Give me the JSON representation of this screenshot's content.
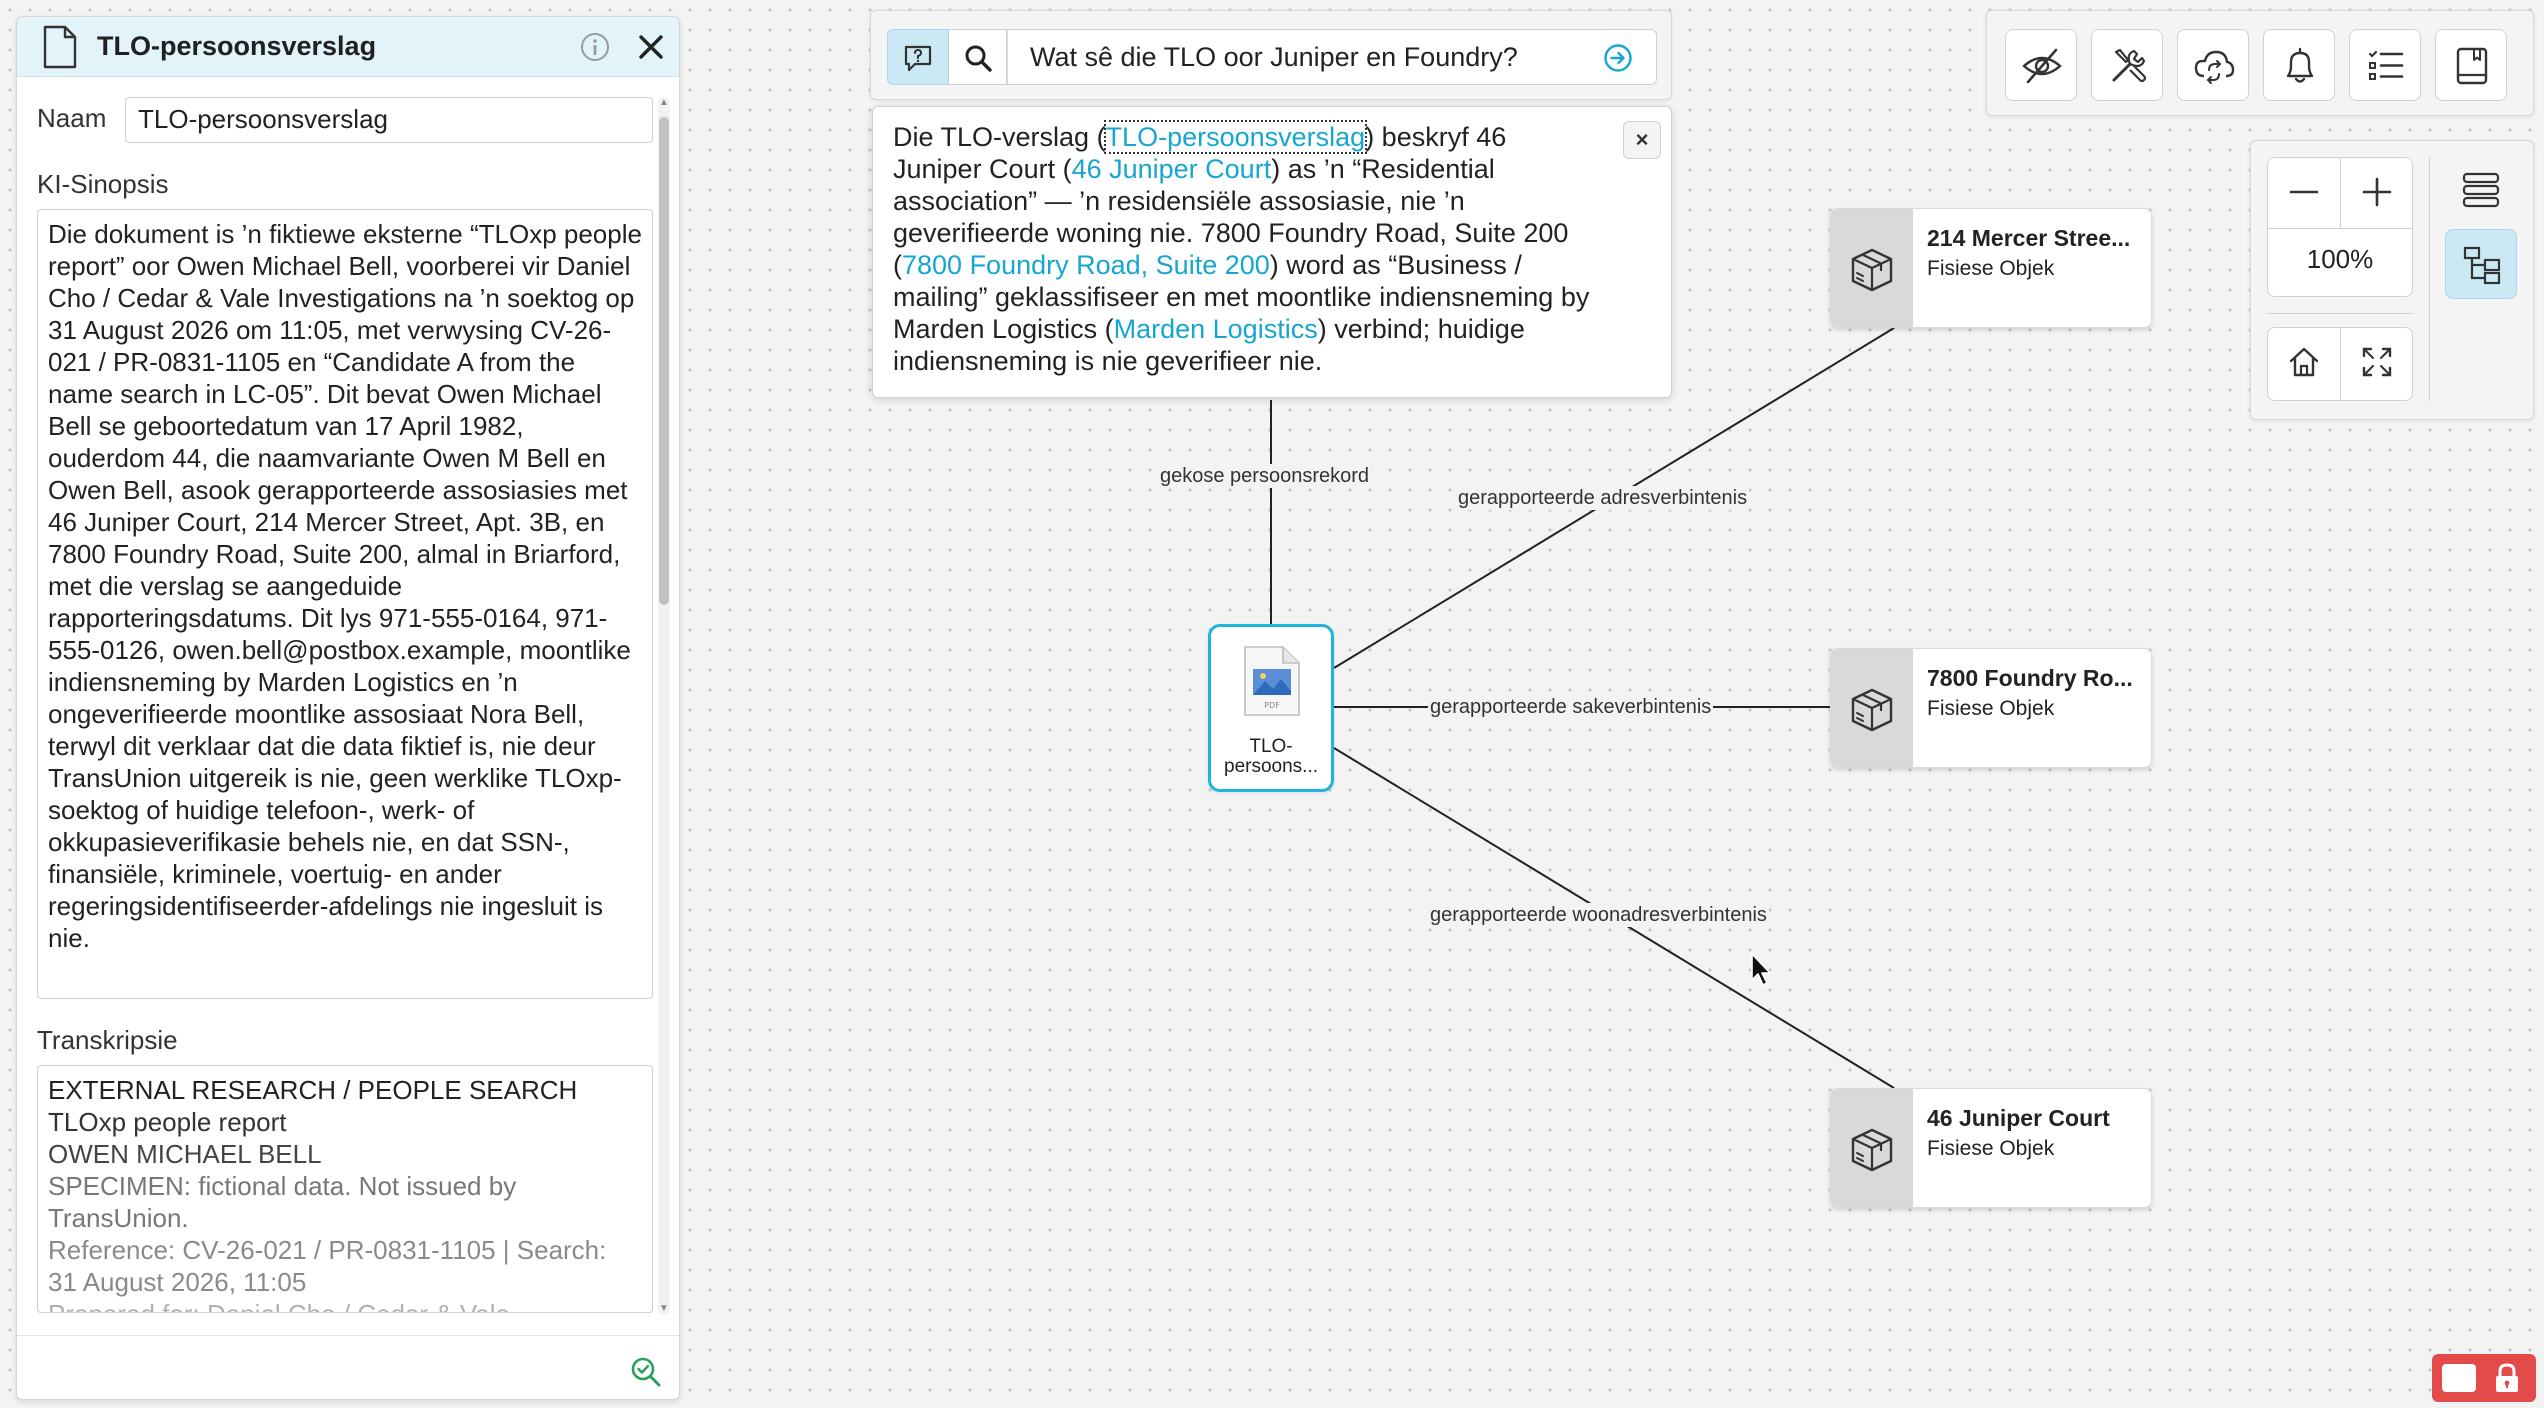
{
  "panel": {
    "title": "TLO-persoonsverslag",
    "name_label": "Naam",
    "name_value": "TLO-persoonsverslag",
    "synopsis_label": "KI-Sinopsis",
    "synopsis_text": "Die dokument is ’n fiktiewe eksterne “TLOxp people report” oor Owen Michael Bell, voorberei vir Daniel Cho / Cedar & Vale Investigations na ’n soektog op 31 August 2026 om 11:05, met verwysing CV-26-021 / PR-0831-1105 en “Candidate A from the name search in LC-05”. Dit bevat Owen Michael Bell se geboortedatum van 17 April 1982, ouderdom 44, die naamvariante Owen M Bell en Owen Bell, asook gerapporteerde assosiasies met 46 Juniper Court, 214 Mercer Street, Apt. 3B, en 7800 Foundry Road, Suite 200, almal in Briarford, met die verslag se aangeduide rapporteringsdatums. Dit lys 971-555-0164, 971-555-0126, owen.bell@postbox.example, moontlike indiensneming by Marden Logistics en ’n ongeverifieerde moontlike assosiaat Nora Bell, terwyl dit verklaar dat die data fiktief is, nie deur TransUnion uitgereik is nie, geen werklike TLOxp-soektog of huidige telefoon-, werk- of okkupasieverifikasie behels nie, en dat SSN-, finansiële, kriminele, voertuig- en ander regeringsidentifiseerder-afdelings nie ingesluit is nie.",
    "transcript_label": "Transkripsie",
    "transcript_lines": [
      "EXTERNAL RESEARCH / PEOPLE SEARCH",
      "TLOxp people report",
      "OWEN MICHAEL BELL",
      "SPECIMEN: fictional data. Not issued by TransUnion.",
      "Reference: CV-26-021 / PR-0831-1105 | Search: 31 August 2026, 11:05",
      "Prepared for: Daniel Cho / Cedar & Vale"
    ]
  },
  "search": {
    "query": "Wat sê die TLO oor Juniper en Foundry?"
  },
  "answer": {
    "t1": "Die TLO-verslag (",
    "link1": "TLO-persoonsverslag",
    "t2": ") beskryf 46 Juniper Court (",
    "link2": "46 Juniper Court",
    "t3": ") as ’n “Residential association” — ’n residensiële assosiasie, nie ’n geverifieerde woning nie. 7800 Foundry Road, Suite 200 (",
    "link3": "7800 Foundry Road, Suite 200",
    "t4": ") word as “Business / mailing” geklassifiseer en met moontlike indiensneming by Marden Logistics (",
    "link4": "Marden Logistics",
    "t5": ") verbind; huidige indiensneming is nie geverifieer nie.",
    "close": "×"
  },
  "toolbar": {
    "icons": [
      "eye-off-icon",
      "tools-icon",
      "cloud-sync-icon",
      "bell-icon",
      "list-icon",
      "notebook-icon"
    ]
  },
  "zoom": {
    "level": "100%"
  },
  "graph": {
    "doc_node_label": "TLO-persoons...",
    "edges": {
      "top": "gekose persoonsrekord",
      "mercer": "gerapporteerde adresverbintenis",
      "foundry": "gerapporteerde sakeverbintenis",
      "juniper": "gerapporteerde woonadresverbintenis"
    },
    "nodes": [
      {
        "title": "214 Mercer Stree...",
        "type": "Fisiese Objek"
      },
      {
        "title": "7800 Foundry Ro...",
        "type": "Fisiese Objek"
      },
      {
        "title": "46 Juniper Court",
        "type": "Fisiese Objek"
      }
    ]
  },
  "colors": {
    "accent": "#1fb3e0",
    "link": "#16a6cf",
    "header_bg": "#e3f3fa",
    "lock": "#e34a4a"
  }
}
